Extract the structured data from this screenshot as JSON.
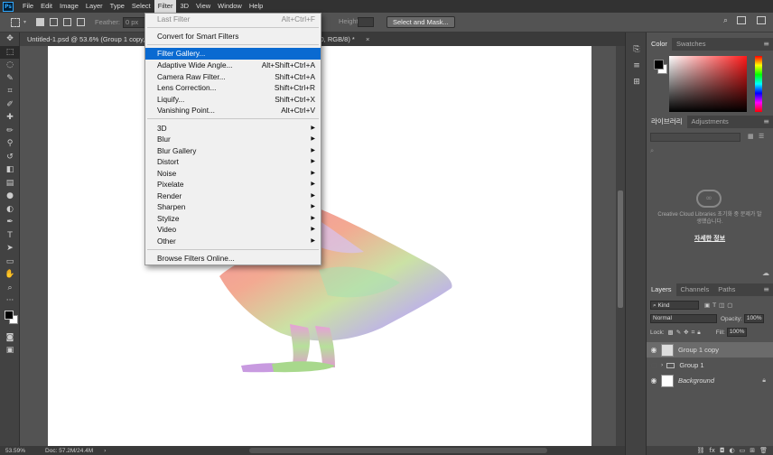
{
  "menubar": {
    "logo": "Ps",
    "items": [
      "File",
      "Edit",
      "Image",
      "Layer",
      "Type",
      "Select",
      "Filter",
      "3D",
      "View",
      "Window",
      "Help"
    ]
  },
  "options": {
    "feather_label": "Feather:",
    "feather_value": "0 px",
    "height_label": "Height:",
    "select_mask": "Select and Mask..."
  },
  "tabs": {
    "doc_tab": "Untitled-1.psd @ 53.6% (Group 1 copy, R",
    "doc_tab_tail": "yer 0, RGB/8) *",
    "close": "×"
  },
  "status": {
    "zoom": "53.59%",
    "doc": "Doc: 57.2M/24.4M"
  },
  "filter_menu": {
    "last_filter": "Last Filter",
    "last_filter_sc": "Alt+Ctrl+F",
    "convert_smart": "Convert for Smart Filters",
    "filter_gallery": "Filter Gallery...",
    "adaptive": "Adaptive Wide Angle...",
    "adaptive_sc": "Alt+Shift+Ctrl+A",
    "camera_raw": "Camera Raw Filter...",
    "camera_raw_sc": "Shift+Ctrl+A",
    "lens": "Lens Correction...",
    "lens_sc": "Shift+Ctrl+R",
    "liquify": "Liquify...",
    "liquify_sc": "Shift+Ctrl+X",
    "vanishing": "Vanishing Point...",
    "vanishing_sc": "Alt+Ctrl+V",
    "sub_3d": "3D",
    "blur": "Blur",
    "blur_gallery": "Blur Gallery",
    "distort": "Distort",
    "noise": "Noise",
    "pixelate": "Pixelate",
    "render": "Render",
    "sharpen": "Sharpen",
    "stylize": "Stylize",
    "video": "Video",
    "other": "Other",
    "browse": "Browse Filters Online...",
    "arrow": "▶"
  },
  "color_panel": {
    "tab_color": "Color",
    "tab_swatches": "Swatches"
  },
  "libraries": {
    "tab_libraries": "라이브러리",
    "tab_adjustments": "Adjustments",
    "message": "Creative Cloud Libraries 초기화 중 문제가 발생했습니다.",
    "more_info": "자세한 정보"
  },
  "layers": {
    "tab_layers": "Layers",
    "tab_channels": "Channels",
    "tab_paths": "Paths",
    "kind": "Kind",
    "blend": "Normal",
    "opacity_label": "Opacity:",
    "opacity": "100%",
    "lock_label": "Lock:",
    "fill_label": "Fill:",
    "fill": "100%",
    "items": [
      {
        "name": "Group 1 copy"
      },
      {
        "name": "Group 1"
      },
      {
        "name": "Background"
      }
    ]
  },
  "colors": {
    "highlight": "#0a6ad1",
    "menubar_bg": "#323232",
    "panel_bg": "#535353"
  }
}
